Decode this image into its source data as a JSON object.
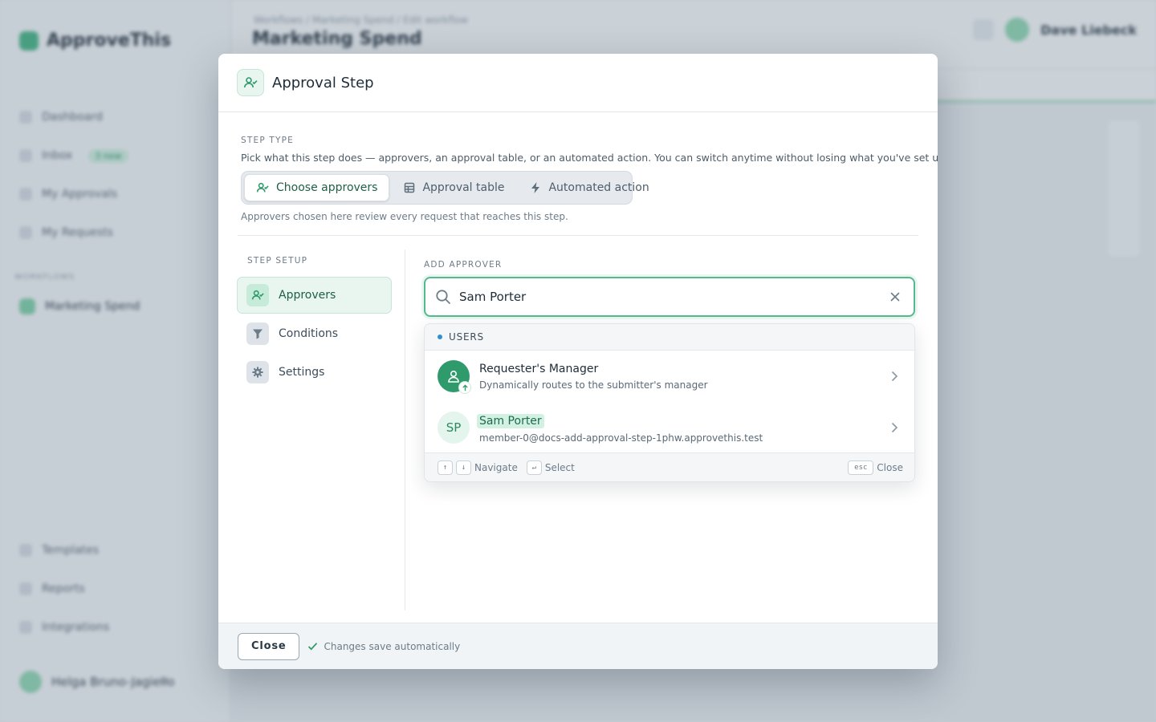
{
  "background": {
    "brand": "ApproveThis",
    "nav": [
      "Dashboard",
      "Inbox",
      "My Approvals",
      "My Requests"
    ],
    "nav_badge": "3 new",
    "section": "WORKFLOWS",
    "workspace": "Marketing Spend",
    "bottom_links": [
      "Templates",
      "Reports",
      "Integrations"
    ],
    "user": "Helga Bruno-Jagiełło",
    "crumbs": "Workflows  /  Marketing Spend  /  Edit workflow",
    "page_title": "Marketing Spend",
    "header_user": "Dave Liebeck"
  },
  "modal": {
    "title": "Approval Step",
    "step_type": {
      "label": "STEP TYPE",
      "description": "Pick what this step does — approvers, an approval table, or an automated action. You can switch anytime without losing what you've set up.",
      "options": [
        {
          "label": "Choose approvers",
          "icon": "user-check-icon",
          "active": true
        },
        {
          "label": "Approval table",
          "icon": "table-icon",
          "active": false
        },
        {
          "label": "Automated action",
          "icon": "lightning-icon",
          "active": false
        }
      ],
      "hint": "Approvers chosen here review every request that reaches this step."
    },
    "setup": {
      "label": "STEP SETUP",
      "items": [
        {
          "label": "Approvers",
          "icon": "user-check-icon",
          "active": true
        },
        {
          "label": "Conditions",
          "icon": "filter-icon",
          "active": false
        },
        {
          "label": "Settings",
          "icon": "gear-icon",
          "active": false
        }
      ]
    },
    "add_approver": {
      "label": "ADD APPROVER",
      "search_value": "Sam Porter",
      "dropdown": {
        "section": "USERS",
        "results": [
          {
            "name": "Requester's Manager",
            "sub": "Dynamically routes to the submitter's manager"
          },
          {
            "initials": "SP",
            "name": "Sam Porter",
            "sub": "member-0@docs-add-approval-step-1phw.approvethis.test"
          }
        ],
        "footer": {
          "up_key": "↑",
          "down_key": "↓",
          "navigate": "Navigate",
          "enter_key": "↵",
          "select": "Select",
          "esc_key": "esc",
          "close": "Close"
        }
      }
    },
    "footer": {
      "close_label": "Close",
      "saved_text": "Changes save automatically"
    }
  },
  "colors": {
    "accent": "#2f9a6c",
    "accent_light": "#e8f6ef",
    "focus_border": "#54b98c"
  }
}
